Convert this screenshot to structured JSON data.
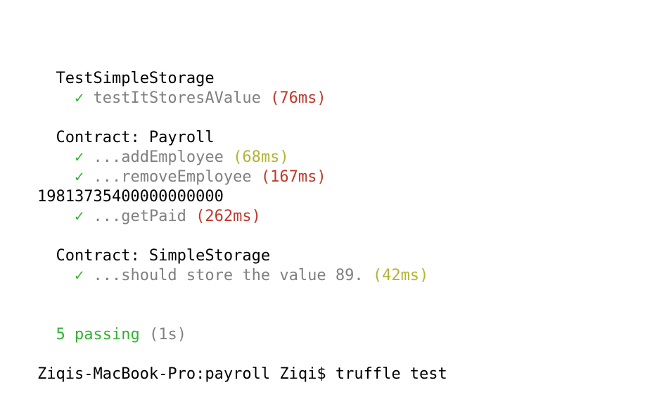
{
  "terminal": {
    "suites": [
      {
        "name": "TestSimpleStorage",
        "tests": [
          {
            "check": "✓",
            "title": "testItStoresAValue",
            "duration": "(76ms)",
            "speed": "slow"
          }
        ]
      },
      {
        "name": "Contract: Payroll",
        "tests": [
          {
            "check": "✓",
            "title": "...addEmployee",
            "duration": "(68ms)",
            "speed": "medium"
          },
          {
            "check": "✓",
            "title": "...removeEmployee",
            "duration": "(167ms)",
            "speed": "slow"
          },
          {
            "check": "✓",
            "title": "...getPaid",
            "duration": "(262ms)",
            "speed": "slow"
          }
        ],
        "log_output": "19813735400000000000"
      },
      {
        "name": "Contract: SimpleStorage",
        "tests": [
          {
            "check": "✓",
            "title": "...should store the value 89.",
            "duration": "(42ms)",
            "speed": "medium"
          }
        ]
      }
    ],
    "summary": {
      "passing": "5 passing",
      "duration": "(1s)"
    },
    "prompt": "Ziqis-MacBook-Pro:payroll Ziqi$",
    "command": "truffle test"
  },
  "colors": {
    "check": "#32b232",
    "slow": "#c0392b",
    "medium": "#b3b334",
    "muted": "#808080"
  }
}
